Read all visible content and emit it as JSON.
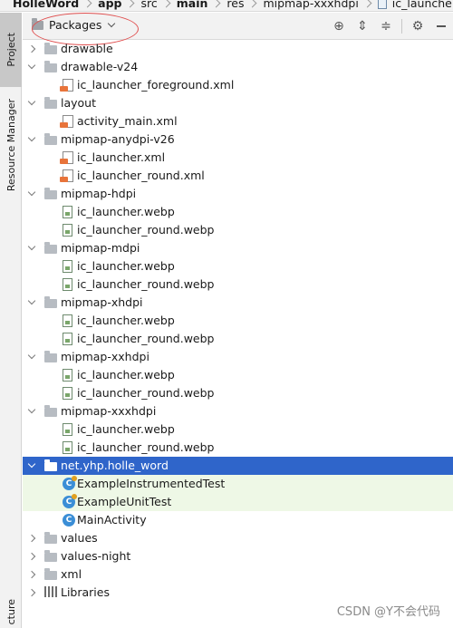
{
  "breadcrumb": [
    {
      "label": "HolleWord",
      "bold": true
    },
    {
      "label": "app",
      "bold": true
    },
    {
      "label": "src",
      "bold": false
    },
    {
      "label": "main",
      "bold": true
    },
    {
      "label": "res",
      "bold": false
    },
    {
      "label": "mipmap-xxxhdpi",
      "bold": false
    },
    {
      "label": "ic_launcher_round.we",
      "bold": false,
      "icon": "file-icon"
    }
  ],
  "side_tabs": [
    {
      "label": "Project",
      "active": true
    },
    {
      "label": "Resource Manager",
      "active": false
    },
    {
      "label": "cture",
      "active": false
    }
  ],
  "toolbar": {
    "view_label": "Packages",
    "icons": [
      "locate-icon",
      "expand-all-icon",
      "collapse-all-icon",
      "gear-icon",
      "minimize-icon"
    ]
  },
  "tree": [
    {
      "label": "drawable",
      "icon": "folder",
      "level": 0,
      "expander": "collapsed"
    },
    {
      "label": "drawable-v24",
      "icon": "folder",
      "level": 0,
      "expander": "expanded"
    },
    {
      "label": "ic_launcher_foreground.xml",
      "icon": "xml",
      "level": 1
    },
    {
      "label": "layout",
      "icon": "folder",
      "level": 0,
      "expander": "expanded"
    },
    {
      "label": "activity_main.xml",
      "icon": "xml",
      "level": 1
    },
    {
      "label": "mipmap-anydpi-v26",
      "icon": "folder",
      "level": 0,
      "expander": "expanded"
    },
    {
      "label": "ic_launcher.xml",
      "icon": "xml",
      "level": 1
    },
    {
      "label": "ic_launcher_round.xml",
      "icon": "xml",
      "level": 1
    },
    {
      "label": "mipmap-hdpi",
      "icon": "folder",
      "level": 0,
      "expander": "expanded"
    },
    {
      "label": "ic_launcher.webp",
      "icon": "webp",
      "level": 1
    },
    {
      "label": "ic_launcher_round.webp",
      "icon": "webp",
      "level": 1
    },
    {
      "label": "mipmap-mdpi",
      "icon": "folder",
      "level": 0,
      "expander": "expanded"
    },
    {
      "label": "ic_launcher.webp",
      "icon": "webp",
      "level": 1
    },
    {
      "label": "ic_launcher_round.webp",
      "icon": "webp",
      "level": 1
    },
    {
      "label": "mipmap-xhdpi",
      "icon": "folder",
      "level": 0,
      "expander": "expanded"
    },
    {
      "label": "ic_launcher.webp",
      "icon": "webp",
      "level": 1
    },
    {
      "label": "ic_launcher_round.webp",
      "icon": "webp",
      "level": 1
    },
    {
      "label": "mipmap-xxhdpi",
      "icon": "folder",
      "level": 0,
      "expander": "expanded"
    },
    {
      "label": "ic_launcher.webp",
      "icon": "webp",
      "level": 1
    },
    {
      "label": "ic_launcher_round.webp",
      "icon": "webp",
      "level": 1
    },
    {
      "label": "mipmap-xxxhdpi",
      "icon": "folder",
      "level": 0,
      "expander": "expanded"
    },
    {
      "label": "ic_launcher.webp",
      "icon": "webp",
      "level": 1
    },
    {
      "label": "ic_launcher_round.webp",
      "icon": "webp",
      "level": 1
    },
    {
      "label": "net.yhp.holle_word",
      "icon": "package",
      "level": 0,
      "expander": "expanded",
      "selected": true
    },
    {
      "label": "ExampleInstrumentedTest",
      "icon": "class-test",
      "level": 1,
      "test": true
    },
    {
      "label": "ExampleUnitTest",
      "icon": "class-test",
      "level": 1,
      "test": true
    },
    {
      "label": "MainActivity",
      "icon": "class",
      "level": 1
    },
    {
      "label": "values",
      "icon": "folder",
      "level": 0,
      "expander": "collapsed"
    },
    {
      "label": "values-night",
      "icon": "folder",
      "level": 0,
      "expander": "collapsed"
    },
    {
      "label": "xml",
      "icon": "folder",
      "level": 0,
      "expander": "collapsed"
    },
    {
      "label": "Libraries",
      "icon": "libraries",
      "level": 0,
      "expander": "collapsed"
    }
  ],
  "colors": {
    "selection": "#2f65ca",
    "test_row": "#eef8e6",
    "highlight_circle": "#e05050"
  },
  "watermark": "CSDN @Y不会代码"
}
